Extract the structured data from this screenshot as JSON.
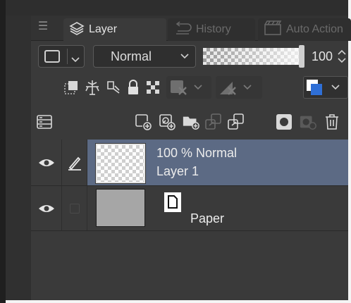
{
  "tabs": [
    {
      "label": "Layer",
      "icon": "layers-icon",
      "active": true
    },
    {
      "label": "History",
      "icon": "history-icon",
      "active": false
    },
    {
      "label": "Auto Action",
      "icon": "auto-action-icon",
      "active": false
    }
  ],
  "blend": {
    "mode": "Normal",
    "opacity": "100"
  },
  "layers": [
    {
      "blend_info": "100 % Normal",
      "name": "Layer 1",
      "visible": true,
      "selected": true,
      "thumbnail": "transparent"
    },
    {
      "name": "Paper",
      "visible": true,
      "selected": false,
      "thumbnail": "paper"
    }
  ],
  "colors": {
    "panel": "#3a3a3a",
    "selected_row": "#5c6a84",
    "text": "#e4e4e4",
    "accent_blue": "#2f6fd6"
  }
}
